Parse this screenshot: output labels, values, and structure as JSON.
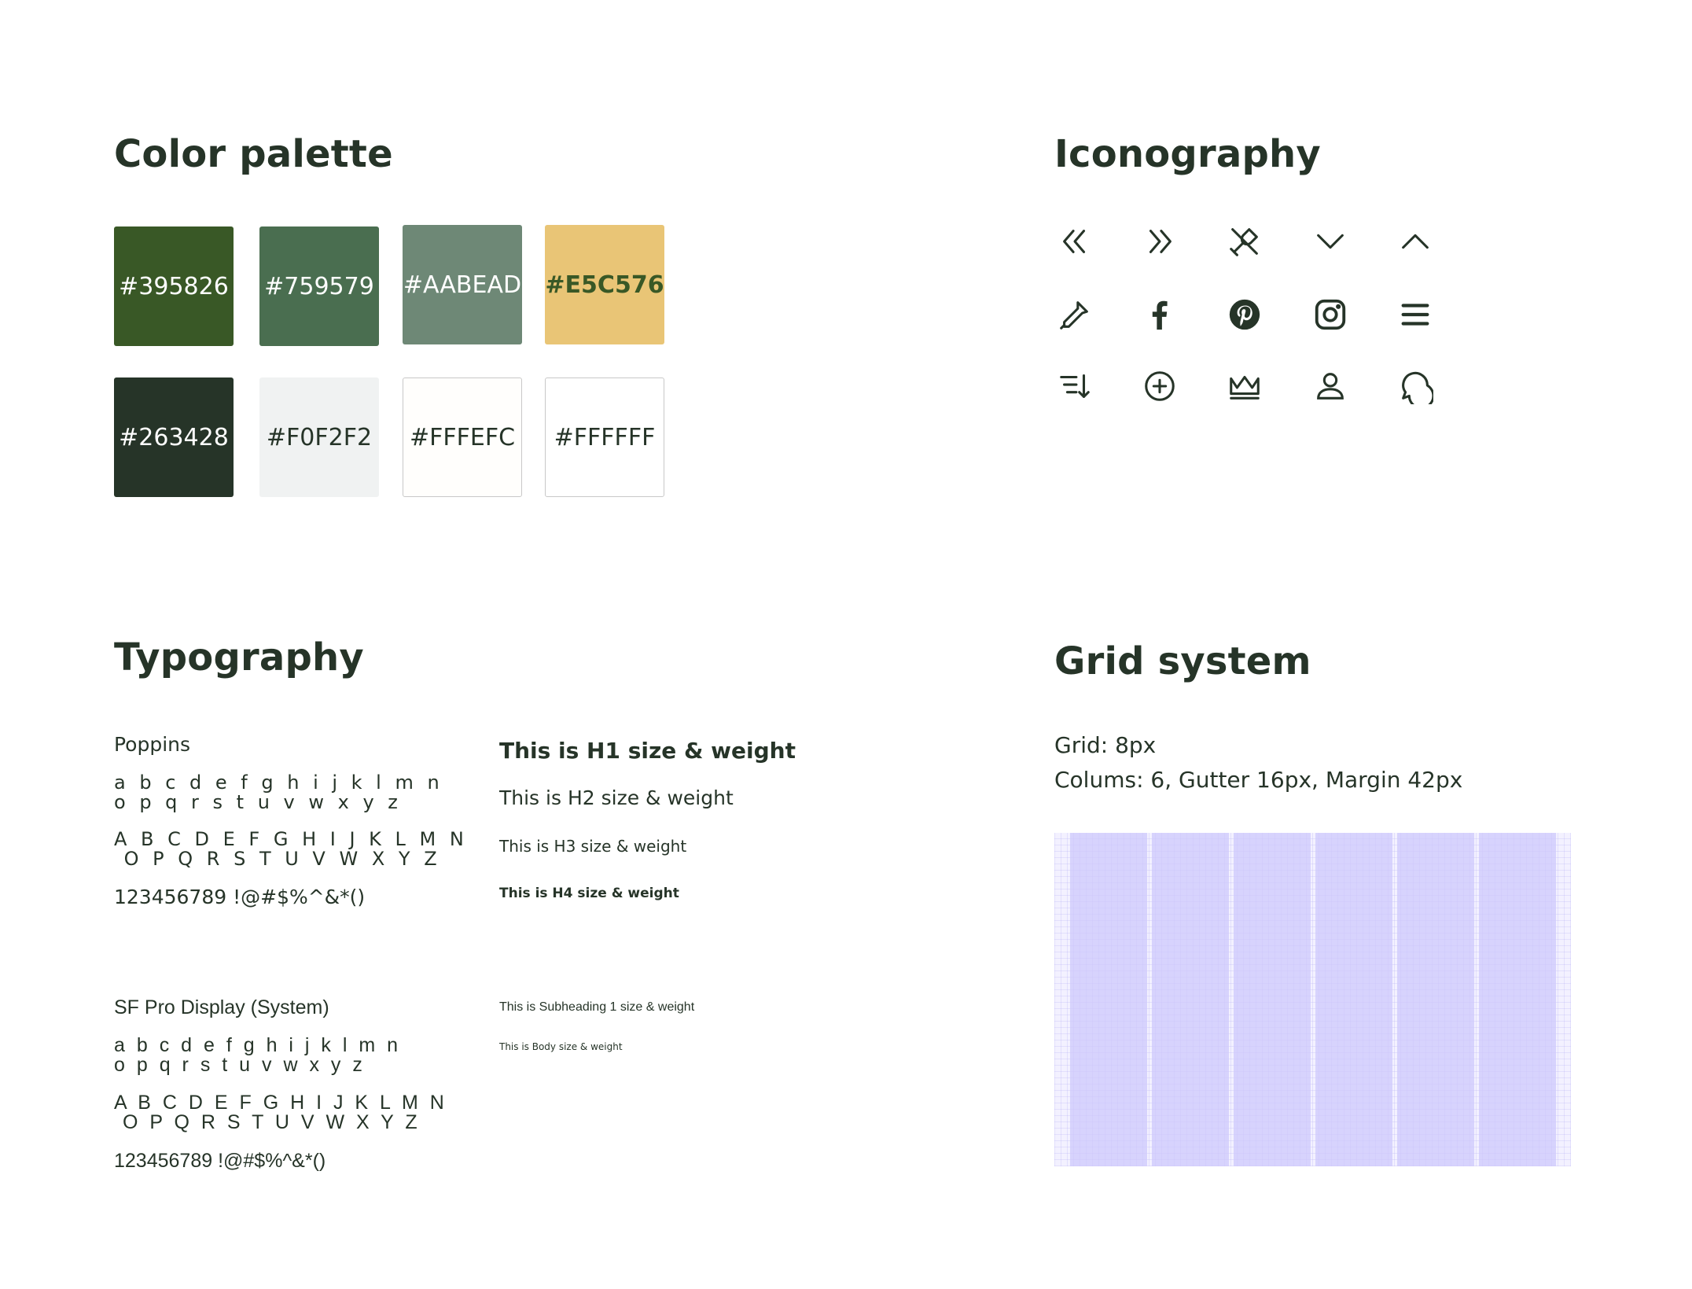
{
  "color_palette": {
    "title": "Color palette",
    "swatches": [
      {
        "label": "#395826",
        "color": "#395826",
        "text_color": "#ffffff"
      },
      {
        "label": "#759579",
        "color": "#4a6e50",
        "text_color": "#ffffff"
      },
      {
        "label": "#AABEAD",
        "color": "#6e8876",
        "text_color": "#ffffff"
      },
      {
        "label": "#E5C576",
        "color": "#e9c576",
        "text_color": "#395826"
      },
      {
        "label": "#263428",
        "color": "#263428",
        "text_color": "#ffffff"
      },
      {
        "label": "#F0F2F2",
        "color": "#f0f2f2",
        "text_color": "#263428"
      },
      {
        "label": "#FFFEFC",
        "color": "#fffefc",
        "text_color": "#263428"
      },
      {
        "label": "#FFFFFF",
        "color": "#ffffff",
        "text_color": "#263428"
      }
    ]
  },
  "iconography": {
    "title": "Iconography",
    "icons": [
      "double-chevron-left-icon",
      "double-chevron-right-icon",
      "wine-off-icon",
      "chevron-down-icon",
      "chevron-up-icon",
      "dropper-icon",
      "facebook-icon",
      "pinterest-icon",
      "instagram-icon",
      "menu-icon",
      "sort-descending-icon",
      "plus-circle-icon",
      "crown-icon",
      "user-icon",
      "chat-bubble-icon"
    ],
    "icon_color": "#263428"
  },
  "typography": {
    "title": "Typography",
    "fonts": [
      {
        "name": "Poppins",
        "lower_1": "a b c d e f g h i j k l m n",
        "lower_2": "o p q r s t u v w x y z",
        "upper_1": "A B C D E F G H I J K L M N",
        "upper_2": " O P Q R S T U V W X Y Z",
        "symbols": "123456789 !@#$%^&*()"
      },
      {
        "name": "SF Pro Display (System)",
        "lower_1": "a b c d e f g h i j k l m n",
        "lower_2": "o p q r s t u v w x y z",
        "upper_1": "A B C D E F G H I J K L M N",
        "upper_2": " O P Q R S T U V W X Y Z",
        "symbols": "123456789 !@#$%^&*()"
      }
    ],
    "samples": {
      "h1": "This is H1 size & weight",
      "h2": "This is H2 size & weight",
      "h3": "This is H3 size & weight",
      "h4": "This is H4 size & weight",
      "subheading1": "This is Subheading 1 size & weight",
      "body": "This is Body size & weight"
    }
  },
  "grid_system": {
    "title": "Grid system",
    "grid_line": "Grid: 8px",
    "columns_line": "Colums: 6, Gutter 16px, Margin 42px",
    "columns": 6,
    "column_color": "#d6d3ff"
  }
}
